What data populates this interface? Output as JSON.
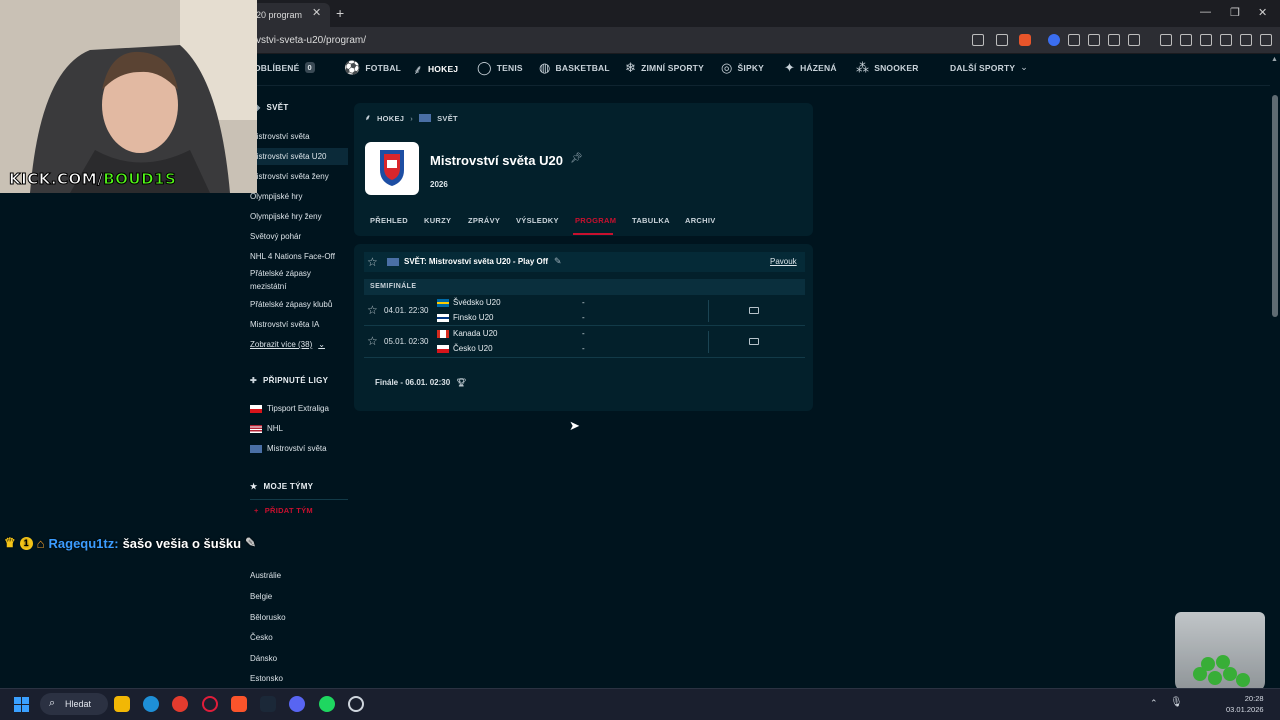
{
  "browser": {
    "tab_title": "20 program",
    "url": "vstvi-sveta-u20/program/"
  },
  "nav": {
    "items": [
      "OBLÍBENÉ",
      "FOTBAL",
      "HOKEJ",
      "TENIS",
      "BASKETBAL",
      "ZIMNÍ SPORTY",
      "ŠIPKY",
      "HÁZENÁ",
      "SNOOKER",
      "DALŠÍ SPORTY"
    ],
    "favorites_count": "0",
    "active": "HOKEJ"
  },
  "sidebar": {
    "section_title": "SVĚT",
    "links": [
      "Mistrovství světa",
      "Mistrovství světa U20",
      "Mistrovství světa ženy",
      "Olympijské hry",
      "Olympijské hry ženy",
      "Světový pohár",
      "NHL 4 Nations Face-Off",
      "Přátelské zápasy mezistátní",
      "Přátelské zápasy klubů",
      "Mistrovství světa IA"
    ],
    "show_more": "Zobrazit více (38)",
    "pinned_title": "PŘIPNUTÉ LIGY",
    "pinned": [
      "Tipsport Extraliga",
      "NHL",
      "Mistrovství světa"
    ],
    "my_teams_title": "MOJE TÝMY",
    "add_team": "PŘIDAT TÝM",
    "countries": [
      "Austrálie",
      "Belgie",
      "Bělorusko",
      "Česko",
      "Dánsko",
      "Estonsko"
    ]
  },
  "header": {
    "breadcrumb": [
      "HOKEJ",
      "SVĚT"
    ],
    "title": "Mistrovství světa U20",
    "season": "2026",
    "tabs": [
      "PŘEHLED",
      "KURZY",
      "ZPRÁVY",
      "VÝSLEDKY",
      "PROGRAM",
      "TABULKA",
      "ARCHIV"
    ],
    "active_tab": "PROGRAM"
  },
  "matches": {
    "league": "SVĚT: Mistrovství světa U20 - Play Off",
    "bracket_link": "Pavouk",
    "round": "SEMIFINÁLE",
    "games": [
      {
        "time": "04.01. 22:30",
        "home": "Švédsko U20",
        "away": "Finsko U20",
        "home_score": "-",
        "away_score": "-"
      },
      {
        "time": "05.01. 02:30",
        "home": "Kanada U20",
        "away": "Česko U20",
        "home_score": "-",
        "away_score": "-"
      }
    ],
    "final": "Finále - 06.01. 02:30"
  },
  "overlay": {
    "kick_prefix": "KICK.COM/",
    "kick_channel": "BOUD1S",
    "chat_badge": "1",
    "chat_user": "Ragequ1tz:",
    "chat_msg": "šašo vešia o šušku"
  },
  "taskbar": {
    "search": "Hledat",
    "time": "20:28",
    "date": "03.01.2026"
  },
  "colors": {
    "background": "#00141e",
    "card": "#03202b",
    "accent": "#c8102e",
    "kick_green": "#53fc18"
  }
}
